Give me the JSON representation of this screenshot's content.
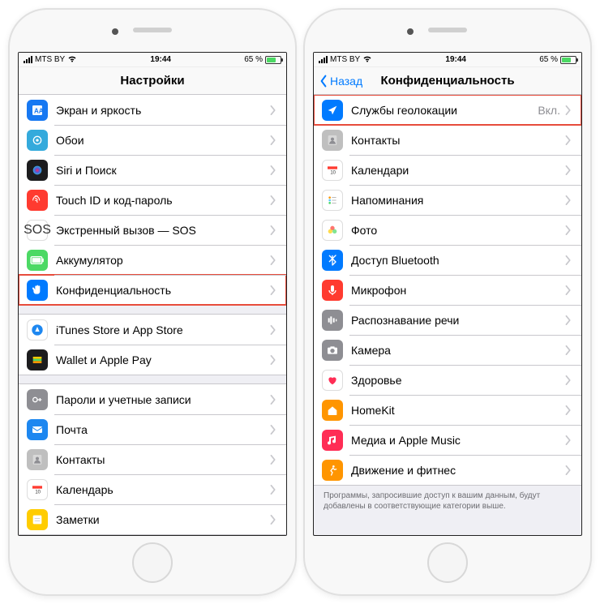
{
  "status": {
    "carrier": "MTS BY",
    "time": "19:44",
    "battery": "65 %"
  },
  "left": {
    "title": "Настройки",
    "groups": [
      {
        "rows": [
          {
            "label": "Экран и яркость",
            "icon": "display-icon",
            "bg": "#1778f2"
          },
          {
            "label": "Обои",
            "icon": "wallpaper-icon",
            "bg": "#34aadc"
          },
          {
            "label": "Siri и Поиск",
            "icon": "siri-icon",
            "bg": "#1c1c1e"
          },
          {
            "label": "Touch ID и код-пароль",
            "icon": "fingerprint-icon",
            "bg": "#ff3b30"
          },
          {
            "label": "Экстренный вызов — SOS",
            "icon": "sos-icon",
            "bg": "#ffffff"
          },
          {
            "label": "Аккумулятор",
            "icon": "battery-icon",
            "bg": "#4cd964"
          },
          {
            "label": "Конфиденциальность",
            "icon": "hand-icon",
            "bg": "#007aff",
            "highlight": true
          }
        ]
      },
      {
        "rows": [
          {
            "label": "iTunes Store и App Store",
            "icon": "appstore-icon",
            "bg": "#ffffff"
          },
          {
            "label": "Wallet и Apple Pay",
            "icon": "wallet-icon",
            "bg": "#1c1c1e"
          }
        ]
      },
      {
        "rows": [
          {
            "label": "Пароли и учетные записи",
            "icon": "key-icon",
            "bg": "#8e8e93"
          },
          {
            "label": "Почта",
            "icon": "mail-icon",
            "bg": "#1d87f0"
          },
          {
            "label": "Контакты",
            "icon": "contacts-icon",
            "bg": "#bfbfbf"
          },
          {
            "label": "Календарь",
            "icon": "calendar-icon",
            "bg": "#ffffff"
          },
          {
            "label": "Заметки",
            "icon": "notes-icon",
            "bg": "#ffcc00"
          }
        ]
      }
    ]
  },
  "right": {
    "back": "Назад",
    "title": "Конфиденциальность",
    "footer": "Программы, запросившие доступ к вашим данным, будут добавлены в соответствующие категории выше.",
    "groups": [
      {
        "rows": [
          {
            "label": "Службы геолокации",
            "value": "Вкл.",
            "icon": "location-icon",
            "bg": "#007aff",
            "highlight": true
          },
          {
            "label": "Контакты",
            "icon": "contacts-icon",
            "bg": "#bfbfbf"
          },
          {
            "label": "Календари",
            "icon": "calendar-icon",
            "bg": "#ffffff"
          },
          {
            "label": "Напоминания",
            "icon": "reminders-icon",
            "bg": "#ffffff"
          },
          {
            "label": "Фото",
            "icon": "photos-icon",
            "bg": "#ffffff"
          },
          {
            "label": "Доступ Bluetooth",
            "icon": "bluetooth-icon",
            "bg": "#007aff"
          },
          {
            "label": "Микрофон",
            "icon": "microphone-icon",
            "bg": "#ff3b30"
          },
          {
            "label": "Распознавание речи",
            "icon": "speech-icon",
            "bg": "#8e8e93"
          },
          {
            "label": "Камера",
            "icon": "camera-icon",
            "bg": "#8e8e93"
          },
          {
            "label": "Здоровье",
            "icon": "health-icon",
            "bg": "#ffffff"
          },
          {
            "label": "HomeKit",
            "icon": "homekit-icon",
            "bg": "#ff9500"
          },
          {
            "label": "Медиа и Apple Music",
            "icon": "music-icon",
            "bg": "#ff2d55"
          },
          {
            "label": "Движение и фитнес",
            "icon": "motion-icon",
            "bg": "#ff9500"
          }
        ]
      }
    ]
  }
}
